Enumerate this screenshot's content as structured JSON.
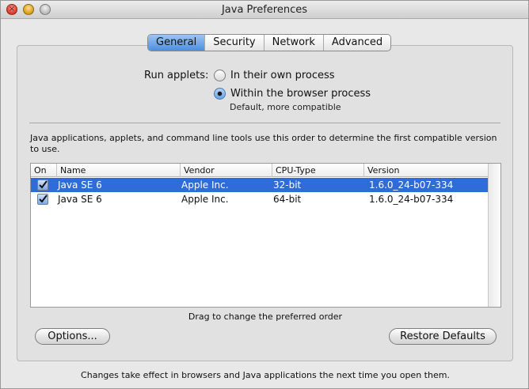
{
  "window": {
    "title": "Java Preferences"
  },
  "tabs": [
    {
      "label": "General",
      "active": true
    },
    {
      "label": "Security",
      "active": false
    },
    {
      "label": "Network",
      "active": false
    },
    {
      "label": "Advanced",
      "active": false
    }
  ],
  "run_applets": {
    "label": "Run applets:",
    "options": [
      {
        "label": "In their own process",
        "selected": false
      },
      {
        "label": "Within the browser process",
        "selected": true,
        "sublabel": "Default, more compatible"
      }
    ]
  },
  "description": "Java applications, applets, and command line tools use this order to determine the first compatible version to use.",
  "table": {
    "columns": [
      "On",
      "Name",
      "Vendor",
      "CPU-Type",
      "Version"
    ],
    "rows": [
      {
        "on": true,
        "name": "Java SE 6",
        "vendor": "Apple Inc.",
        "cpu": "32-bit",
        "version": "1.6.0_24-b07-334",
        "selected": true
      },
      {
        "on": true,
        "name": "Java SE 6",
        "vendor": "Apple Inc.",
        "cpu": "64-bit",
        "version": "1.6.0_24-b07-334",
        "selected": false
      }
    ]
  },
  "drag_hint": "Drag to change the preferred order",
  "buttons": {
    "options": "Options...",
    "restore": "Restore Defaults"
  },
  "footer": "Changes take effect in browsers and Java applications the next time you open them.",
  "colors": {
    "selection": "#2f6cd8",
    "tab_active": "#4b8fe0"
  }
}
